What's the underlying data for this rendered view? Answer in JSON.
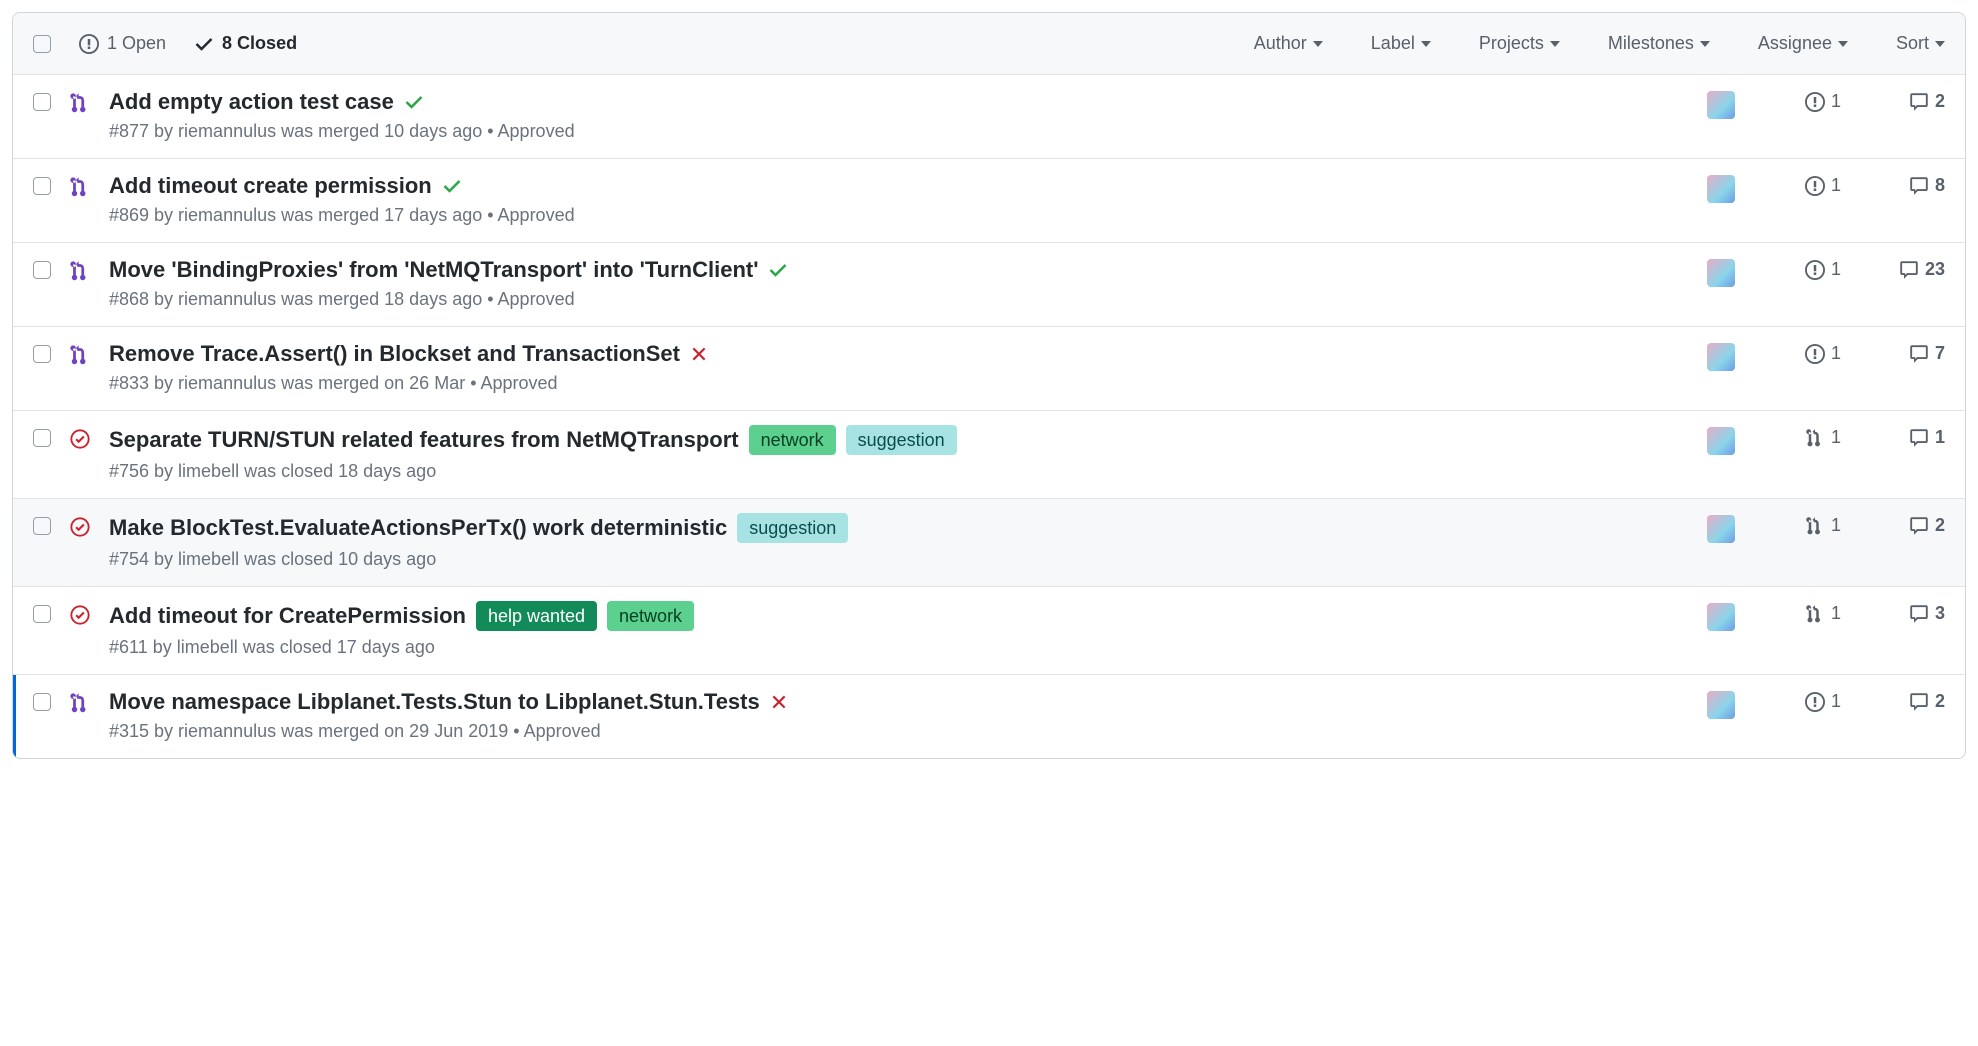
{
  "header": {
    "open_count": "1 Open",
    "closed_count": "8 Closed",
    "filters": {
      "author": "Author",
      "label": "Label",
      "projects": "Projects",
      "milestones": "Milestones",
      "assignee": "Assignee",
      "sort": "Sort"
    }
  },
  "label_styles": {
    "network": {
      "bg": "#5bd08f",
      "fg": "#064022"
    },
    "suggestion": {
      "bg": "#a8e3e3",
      "fg": "#0b4d4d"
    },
    "help wanted": {
      "bg": "#128a5a",
      "fg": "#ffffff"
    }
  },
  "issues": [
    {
      "icon": "pr-merged",
      "title": "Add empty action test case",
      "status": "check-green",
      "sub": "#877 by riemannulus was merged 10 days ago • Approved",
      "linked_icon": "issue",
      "linked_count": "1",
      "comments": "2",
      "labels": []
    },
    {
      "icon": "pr-merged",
      "title": "Add timeout create permission",
      "status": "check-green",
      "sub": "#869 by riemannulus was merged 17 days ago • Approved",
      "linked_icon": "issue",
      "linked_count": "1",
      "comments": "8",
      "labels": []
    },
    {
      "icon": "pr-merged",
      "title": "Move 'BindingProxies' from 'NetMQTransport' into 'TurnClient'",
      "status": "check-green",
      "sub": "#868 by riemannulus was merged 18 days ago • Approved",
      "linked_icon": "issue",
      "linked_count": "1",
      "comments": "23",
      "labels": []
    },
    {
      "icon": "pr-merged",
      "title": "Remove Trace.Assert() in Blockset and TransactionSet",
      "status": "x-red",
      "sub": "#833 by riemannulus was merged on 26 Mar • Approved",
      "linked_icon": "issue",
      "linked_count": "1",
      "comments": "7",
      "labels": []
    },
    {
      "icon": "issue-closed",
      "title": "Separate TURN/STUN related features from NetMQTransport",
      "status": "",
      "sub": "#756 by limebell was closed 18 days ago",
      "linked_icon": "pr",
      "linked_count": "1",
      "comments": "1",
      "labels": [
        "network",
        "suggestion"
      ]
    },
    {
      "icon": "issue-closed",
      "title": "Make BlockTest.EvaluateActionsPerTx() work deterministic",
      "status": "",
      "sub": "#754 by limebell was closed 10 days ago",
      "linked_icon": "pr",
      "linked_count": "1",
      "comments": "2",
      "labels": [
        "suggestion"
      ],
      "hover": true
    },
    {
      "icon": "issue-closed",
      "title": "Add timeout for CreatePermission",
      "status": "",
      "sub": "#611 by limebell was closed 17 days ago",
      "linked_icon": "pr",
      "linked_count": "1",
      "comments": "3",
      "labels": [
        "help wanted",
        "network"
      ]
    },
    {
      "icon": "pr-merged",
      "title": "Move namespace Libplanet.Tests.Stun to Libplanet.Stun.Tests",
      "status": "x-red",
      "sub": "#315 by riemannulus was merged on 29 Jun 2019 • Approved",
      "linked_icon": "issue",
      "linked_count": "1",
      "comments": "2",
      "labels": [],
      "lastSelected": true
    }
  ]
}
